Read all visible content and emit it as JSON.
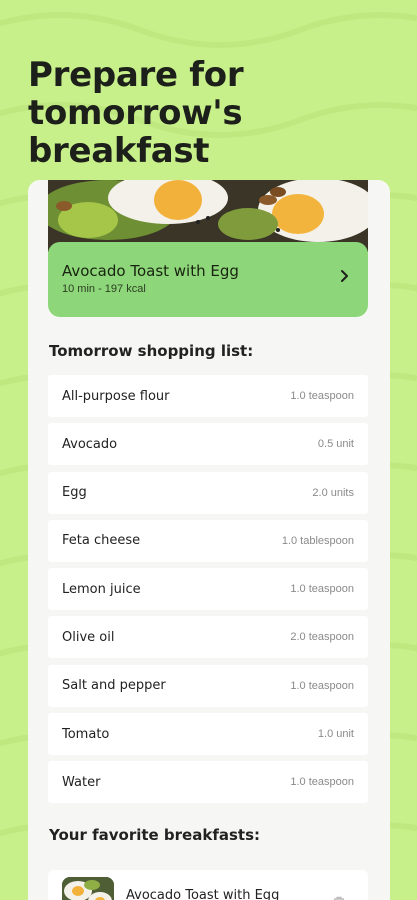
{
  "headline": "Prepare for tomorrow's breakfast",
  "recipe": {
    "title": "Avocado Toast with Egg",
    "meta": "10 min - 197 kcal"
  },
  "shopping": {
    "title": "Tomorrow shopping list:",
    "items": [
      {
        "name": "All-purpose flour",
        "qty": "1.0 teaspoon"
      },
      {
        "name": "Avocado",
        "qty": "0.5 unit"
      },
      {
        "name": "Egg",
        "qty": "2.0 units"
      },
      {
        "name": "Feta cheese",
        "qty": "1.0 tablespoon"
      },
      {
        "name": "Lemon juice",
        "qty": "1.0 teaspoon"
      },
      {
        "name": "Olive oil",
        "qty": "2.0 teaspoon"
      },
      {
        "name": "Salt and pepper",
        "qty": "1.0 teaspoon"
      },
      {
        "name": "Tomato",
        "qty": "1.0 unit"
      },
      {
        "name": "Water",
        "qty": "1.0 teaspoon"
      }
    ]
  },
  "favorites": {
    "title": "Your favorite breakfasts:",
    "items": [
      {
        "title": "Avocado Toast with Egg"
      }
    ]
  },
  "colors": {
    "background": "#c8f08a",
    "banner": "#8ed67a",
    "card": "#f6f7f4"
  },
  "icons": {
    "banner_arrow": "chevron-right-icon",
    "favorite_action": "trash-icon"
  }
}
